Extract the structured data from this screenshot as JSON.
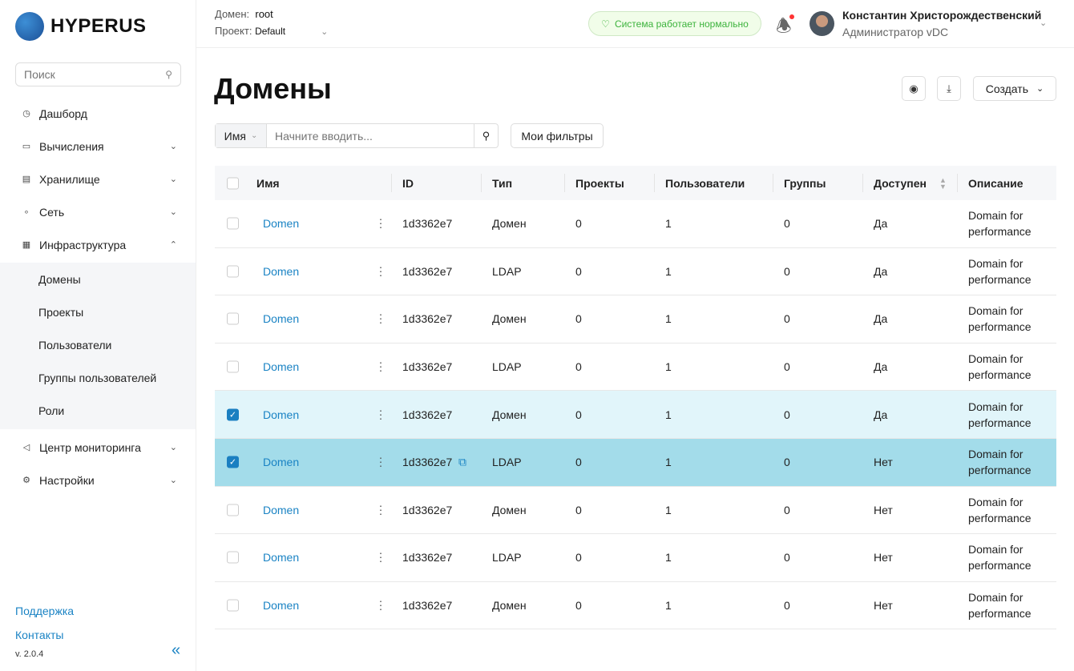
{
  "brand": "HYPERUS",
  "sidebar": {
    "search_placeholder": "Поиск",
    "items": [
      {
        "label": "Дашборд",
        "icon": "dashboard-icon"
      },
      {
        "label": "Вычисления",
        "icon": "monitor-icon"
      },
      {
        "label": "Хранилище",
        "icon": "storage-icon"
      },
      {
        "label": "Сеть",
        "icon": "network-icon"
      },
      {
        "label": "Инфраструктура",
        "icon": "infrastructure-icon"
      },
      {
        "label": "Центр мониторинга",
        "icon": "megaphone-icon"
      },
      {
        "label": "Настройки",
        "icon": "gear-icon"
      }
    ],
    "sub_items": [
      "Домены",
      "Проекты",
      "Пользователи",
      "Группы пользователей",
      "Роли"
    ],
    "support": "Поддержка",
    "contacts": "Контакты",
    "version": "v. 2.0.4"
  },
  "header": {
    "domain_label": "Домен:",
    "domain_value": "root",
    "project_label": "Проект:",
    "project_value": "Default",
    "status": "Система работает нормально",
    "user_name": "Константин Христорождественский",
    "user_role": "Администратор vDC"
  },
  "page": {
    "title": "Домены",
    "create": "Создать",
    "filter_field": "Имя",
    "filter_placeholder": "Начните вводить...",
    "my_filters": "Мои фильтры"
  },
  "table": {
    "columns": [
      "Имя",
      "ID",
      "Тип",
      "Проекты",
      "Пользователи",
      "Группы",
      "Доступен",
      "Описание"
    ],
    "rows": [
      {
        "name": "Domen",
        "id": "1d3362e7",
        "type": "Домен",
        "projects": "0",
        "users": "1",
        "groups": "0",
        "available": "Да",
        "desc1": "Domain for",
        "desc2": "performance",
        "checked": false
      },
      {
        "name": "Domen",
        "id": "1d3362e7",
        "type": "LDAP",
        "projects": "0",
        "users": "1",
        "groups": "0",
        "available": "Да",
        "desc1": "Domain for",
        "desc2": "performance",
        "checked": false
      },
      {
        "name": "Domen",
        "id": "1d3362e7",
        "type": "Домен",
        "projects": "0",
        "users": "1",
        "groups": "0",
        "available": "Да",
        "desc1": "Domain for",
        "desc2": "performance",
        "checked": false
      },
      {
        "name": "Domen",
        "id": "1d3362e7",
        "type": "LDAP",
        "projects": "0",
        "users": "1",
        "groups": "0",
        "available": "Да",
        "desc1": "Domain for",
        "desc2": "performance",
        "checked": false
      },
      {
        "name": "Domen",
        "id": "1d3362e7",
        "type": "Домен",
        "projects": "0",
        "users": "1",
        "groups": "0",
        "available": "Да",
        "desc1": "Domain for",
        "desc2": "performance",
        "checked": true
      },
      {
        "name": "Domen",
        "id": "1d3362e7",
        "type": "LDAP",
        "projects": "0",
        "users": "1",
        "groups": "0",
        "available": "Нет",
        "desc1": "Domain for",
        "desc2": "performance",
        "checked": true
      },
      {
        "name": "Domen",
        "id": "1d3362e7",
        "type": "Домен",
        "projects": "0",
        "users": "1",
        "groups": "0",
        "available": "Нет",
        "desc1": "Domain for",
        "desc2": "performance",
        "checked": false
      },
      {
        "name": "Domen",
        "id": "1d3362e7",
        "type": "LDAP",
        "projects": "0",
        "users": "1",
        "groups": "0",
        "available": "Нет",
        "desc1": "Domain for",
        "desc2": "performance",
        "checked": false
      },
      {
        "name": "Domen",
        "id": "1d3362e7",
        "type": "Домен",
        "projects": "0",
        "users": "1",
        "groups": "0",
        "available": "Нет",
        "desc1": "Domain for",
        "desc2": "performance",
        "checked": false
      }
    ]
  }
}
